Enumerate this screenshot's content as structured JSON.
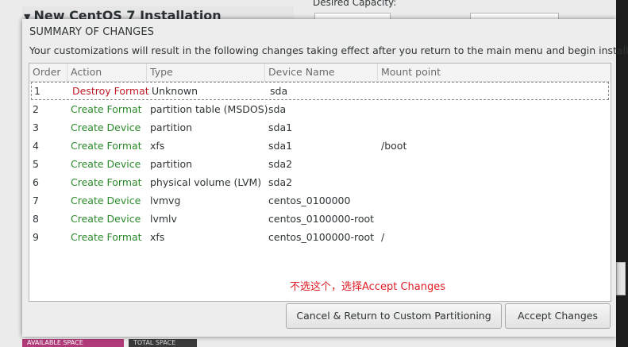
{
  "background": {
    "title": "New CentOS 7 Installation",
    "capacity_label": "Desired Capacity:",
    "available_space": "AVAILABLE SPACE",
    "total_space": "TOTAL SPACE"
  },
  "dialog": {
    "title": "SUMMARY OF CHANGES",
    "description": "Your customizations will result in the following changes taking effect after you return to the main menu and begin installation:",
    "columns": [
      "Order",
      "Action",
      "Type",
      "Device Name",
      "Mount point"
    ],
    "rows": [
      {
        "order": "1",
        "action": "Destroy Format",
        "type": "Unknown",
        "device": "sda",
        "mount": ""
      },
      {
        "order": "2",
        "action": "Create Format",
        "type": "partition table (MSDOS)",
        "device": "sda",
        "mount": ""
      },
      {
        "order": "3",
        "action": "Create Device",
        "type": "partition",
        "device": "sda1",
        "mount": ""
      },
      {
        "order": "4",
        "action": "Create Format",
        "type": "xfs",
        "device": "sda1",
        "mount": "/boot"
      },
      {
        "order": "5",
        "action": "Create Device",
        "type": "partition",
        "device": "sda2",
        "mount": ""
      },
      {
        "order": "6",
        "action": "Create Format",
        "type": "physical volume (LVM)",
        "device": "sda2",
        "mount": ""
      },
      {
        "order": "7",
        "action": "Create Device",
        "type": "lvmvg",
        "device": "centos_0100000",
        "mount": ""
      },
      {
        "order": "8",
        "action": "Create Device",
        "type": "lvmlv",
        "device": "centos_0100000-root",
        "mount": ""
      },
      {
        "order": "9",
        "action": "Create Format",
        "type": "xfs",
        "device": "centos_0100000-root",
        "mount": "/"
      }
    ],
    "annotation": "不选这个，选择Accept Changes",
    "cancel_label": "Cancel & Return to Custom Partitioning",
    "accept_label": "Accept Changes"
  },
  "colors": {
    "destroy": "#c01c28",
    "create": "#2a8a2a",
    "annotation": "#e01b24"
  }
}
